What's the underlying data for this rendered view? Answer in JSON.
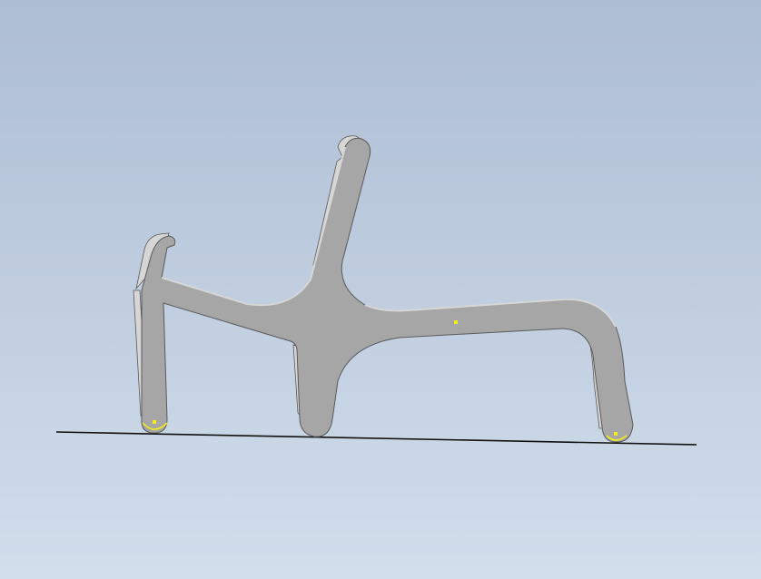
{
  "viewport": {
    "background_top": "#adbdd3",
    "background_bottom": "#d2deec"
  },
  "part": {
    "fill_color": "#a6a6a6",
    "highlight_color": "#d6d6d6",
    "shadow_color": "#8e8e8e",
    "outline_color": "#5a5a5a"
  },
  "ground_line": {
    "color": "#111111"
  },
  "contact_markers": {
    "color": "#f2ee1a",
    "count": 3
  }
}
